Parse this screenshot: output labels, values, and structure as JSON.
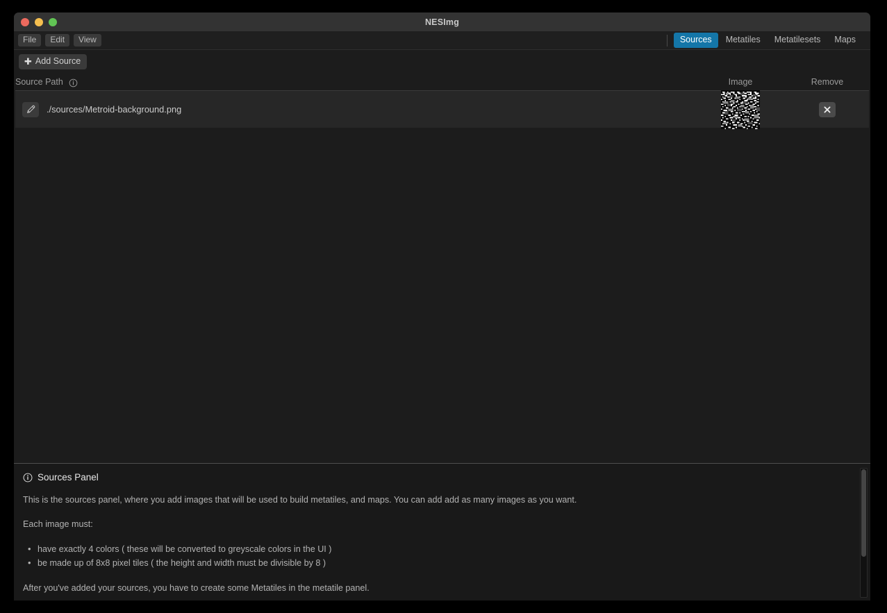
{
  "window": {
    "title": "NESImg",
    "controls": {
      "close": "close-button",
      "minimize": "minimize-button",
      "maximize": "maximize-button"
    }
  },
  "menubar": {
    "items": [
      {
        "label": "File"
      },
      {
        "label": "Edit"
      },
      {
        "label": "View"
      }
    ]
  },
  "tabs": [
    {
      "label": "Sources",
      "active": true
    },
    {
      "label": "Metatiles",
      "active": false
    },
    {
      "label": "Metatilesets",
      "active": false
    },
    {
      "label": "Maps",
      "active": false
    }
  ],
  "toolbar": {
    "add_source_label": "Add Source",
    "add_source_icon": "plus-icon"
  },
  "table": {
    "columns": {
      "path": "Source Path",
      "path_info_icon": "info-icon",
      "image": "Image",
      "remove": "Remove"
    },
    "rows": [
      {
        "edit_icon": "pencil-icon",
        "path": "./sources/Metroid-background.png",
        "thumbnail": "metroid-background-thumbnail",
        "remove_icon": "close-x-icon"
      }
    ]
  },
  "info_panel": {
    "icon": "info-icon",
    "title": "Sources Panel",
    "paragraph": "This is the sources panel, where you add images that will be used to build metatiles, and maps. You can add add as many images as you want.",
    "requirements_heading": "Each image must:",
    "requirements": [
      "have exactly 4 colors ( these will be converted to greyscale colors in the UI )",
      "be made up of 8x8 pixel tiles ( the height and width must be divisible by 8 )"
    ],
    "footer_paragraph": "After you've added your sources, you have to create some Metatiles in the metatile panel."
  },
  "colors": {
    "accent": "#1476a8",
    "window_background": "#1c1c1c",
    "titlebar": "#333333",
    "row_background": "#272727",
    "close_light": "#ed6a5e",
    "minimize_light": "#f5bf4f",
    "maximize_light": "#61c454"
  }
}
